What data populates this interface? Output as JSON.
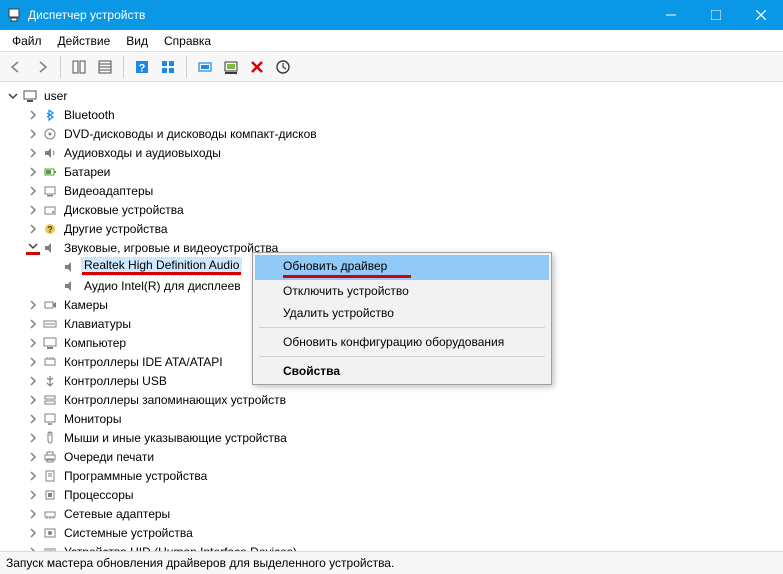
{
  "window": {
    "title": "Диспетчер устройств"
  },
  "menubar": {
    "file": "Файл",
    "action": "Действие",
    "view": "Вид",
    "help": "Справка"
  },
  "tree": {
    "root": "user",
    "n0": "Bluetooth",
    "n1": "DVD-дисководы и дисководы компакт-дисков",
    "n2": "Аудиовходы и аудиовыходы",
    "n3": "Батареи",
    "n4": "Видеоадаптеры",
    "n5": "Дисковые устройства",
    "n6": "Другие устройства",
    "n7": "Звуковые, игровые и видеоустройства",
    "n7_0": "Realtek High Definition Audio",
    "n7_1": "Аудио Intel(R) для дисплеев",
    "n8": "Камеры",
    "n9": "Клавиатуры",
    "n10": "Компьютер",
    "n11": "Контроллеры IDE ATA/ATAPI",
    "n12": "Контроллеры USB",
    "n13": "Контроллеры запоминающих устройств",
    "n14": "Мониторы",
    "n15": "Мыши и иные указывающие устройства",
    "n16": "Очереди печати",
    "n17": "Программные устройства",
    "n18": "Процессоры",
    "n19": "Сетевые адаптеры",
    "n20": "Системные устройства",
    "n21": "Устройства HID (Human Interface Devices)"
  },
  "context_menu": {
    "update_driver": "Обновить драйвер",
    "disable_device": "Отключить устройство",
    "uninstall_device": "Удалить устройство",
    "scan_hardware": "Обновить конфигурацию оборудования",
    "properties": "Свойства"
  },
  "statusbar": {
    "text": "Запуск мастера обновления драйверов для выделенного устройства."
  }
}
